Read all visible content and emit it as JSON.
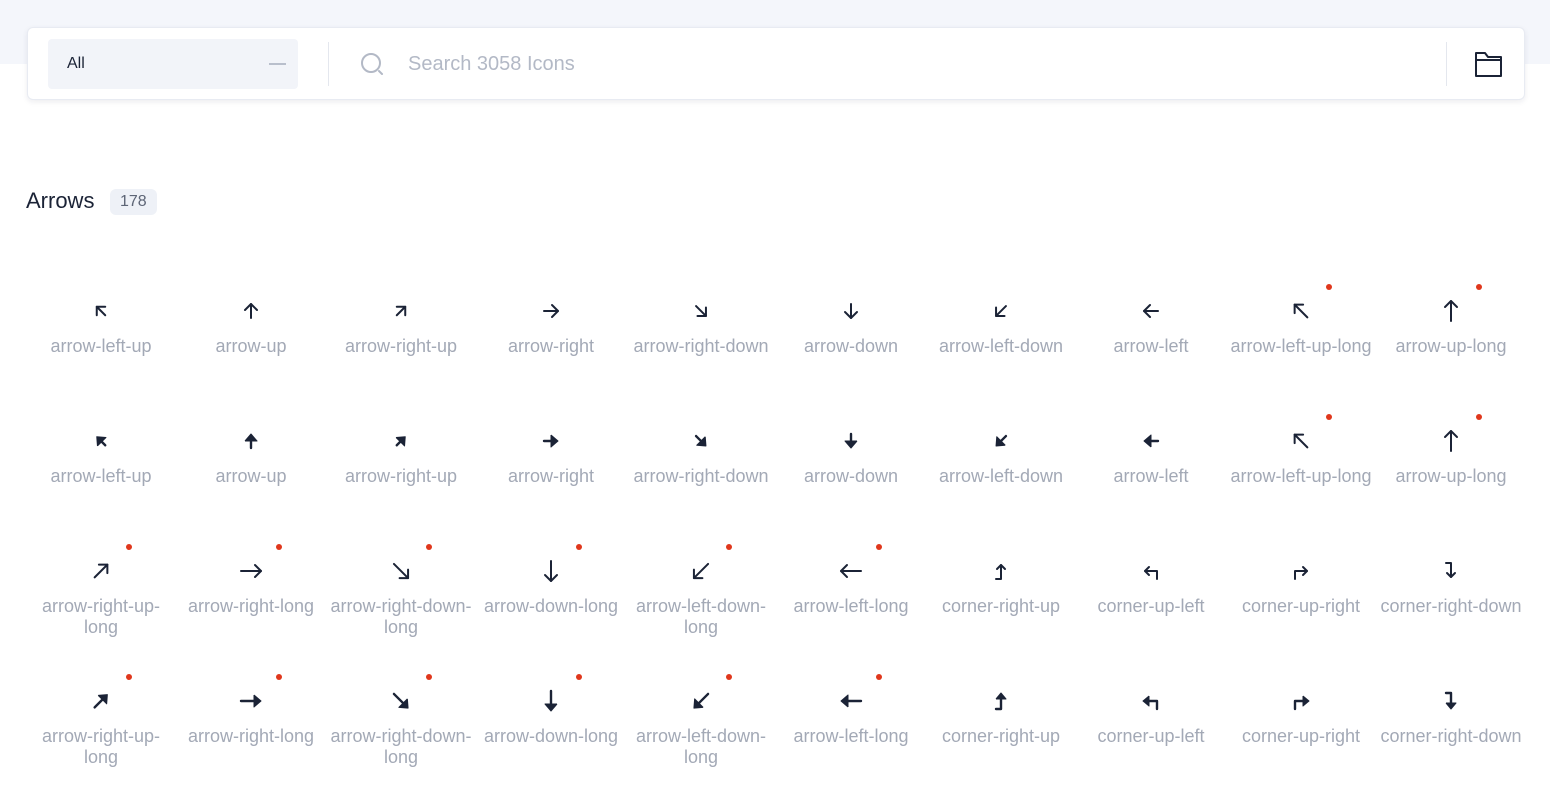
{
  "toolbar": {
    "category": "All",
    "search_placeholder": "Search 3058 Icons"
  },
  "section": {
    "title": "Arrows",
    "count": "178"
  },
  "colors": {
    "icon": "#1b2336",
    "label": "#a3a9b6",
    "new_dot": "#e0371c"
  },
  "icons": [
    {
      "label": "arrow-left-up",
      "shape": "diag-ul",
      "style": "outline",
      "is_new": false
    },
    {
      "label": "arrow-up",
      "shape": "up",
      "style": "outline",
      "is_new": false
    },
    {
      "label": "arrow-right-up",
      "shape": "diag-ur",
      "style": "outline",
      "is_new": false
    },
    {
      "label": "arrow-right",
      "shape": "right",
      "style": "outline",
      "is_new": false
    },
    {
      "label": "arrow-right-down",
      "shape": "diag-dr",
      "style": "outline",
      "is_new": false
    },
    {
      "label": "arrow-down",
      "shape": "down",
      "style": "outline",
      "is_new": false
    },
    {
      "label": "arrow-left-down",
      "shape": "diag-dl",
      "style": "outline",
      "is_new": false
    },
    {
      "label": "arrow-left",
      "shape": "left",
      "style": "outline",
      "is_new": false
    },
    {
      "label": "arrow-left-up-long",
      "shape": "long-ul",
      "style": "outline",
      "is_new": true
    },
    {
      "label": "arrow-up-long",
      "shape": "long-up",
      "style": "outline",
      "is_new": true
    },
    {
      "label": "arrow-left-up",
      "shape": "diag-ul",
      "style": "solid",
      "is_new": false
    },
    {
      "label": "arrow-up",
      "shape": "up",
      "style": "solid",
      "is_new": false
    },
    {
      "label": "arrow-right-up",
      "shape": "diag-ur",
      "style": "solid",
      "is_new": false
    },
    {
      "label": "arrow-right",
      "shape": "right",
      "style": "solid",
      "is_new": false
    },
    {
      "label": "arrow-right-down",
      "shape": "diag-dr",
      "style": "solid",
      "is_new": false
    },
    {
      "label": "arrow-down",
      "shape": "down",
      "style": "solid",
      "is_new": false
    },
    {
      "label": "arrow-left-down",
      "shape": "diag-dl",
      "style": "solid",
      "is_new": false
    },
    {
      "label": "arrow-left",
      "shape": "left",
      "style": "solid",
      "is_new": false
    },
    {
      "label": "arrow-left-up-long",
      "shape": "long-ul",
      "style": "outline",
      "is_new": true
    },
    {
      "label": "arrow-up-long",
      "shape": "long-up",
      "style": "outline",
      "is_new": true
    },
    {
      "label": "arrow-right-up-long",
      "shape": "long-ur",
      "style": "outline",
      "is_new": true
    },
    {
      "label": "arrow-right-long",
      "shape": "long-right",
      "style": "outline",
      "is_new": true
    },
    {
      "label": "arrow-right-down-long",
      "shape": "long-dr",
      "style": "outline",
      "is_new": true
    },
    {
      "label": "arrow-down-long",
      "shape": "long-down",
      "style": "outline",
      "is_new": true
    },
    {
      "label": "arrow-left-down-long",
      "shape": "long-dl",
      "style": "outline",
      "is_new": true
    },
    {
      "label": "arrow-left-long",
      "shape": "long-left",
      "style": "outline",
      "is_new": true
    },
    {
      "label": "corner-right-up",
      "shape": "corner-right-up",
      "style": "outline",
      "is_new": false
    },
    {
      "label": "corner-up-left",
      "shape": "corner-up-left",
      "style": "outline",
      "is_new": false
    },
    {
      "label": "corner-up-right",
      "shape": "corner-up-right",
      "style": "outline",
      "is_new": false
    },
    {
      "label": "corner-right-down",
      "shape": "corner-right-down",
      "style": "outline",
      "is_new": false
    },
    {
      "label": "arrow-right-up-long",
      "shape": "long-ur",
      "style": "solid",
      "is_new": true
    },
    {
      "label": "arrow-right-long",
      "shape": "long-right",
      "style": "solid",
      "is_new": true
    },
    {
      "label": "arrow-right-down-long",
      "shape": "long-dr",
      "style": "solid",
      "is_new": true
    },
    {
      "label": "arrow-down-long",
      "shape": "long-down",
      "style": "solid",
      "is_new": true
    },
    {
      "label": "arrow-left-down-long",
      "shape": "long-dl",
      "style": "solid",
      "is_new": true
    },
    {
      "label": "arrow-left-long",
      "shape": "long-left",
      "style": "solid",
      "is_new": true
    },
    {
      "label": "corner-right-up",
      "shape": "corner-right-up",
      "style": "solid",
      "is_new": false
    },
    {
      "label": "corner-up-left",
      "shape": "corner-up-left",
      "style": "solid",
      "is_new": false
    },
    {
      "label": "corner-up-right",
      "shape": "corner-up-right",
      "style": "solid",
      "is_new": false
    },
    {
      "label": "corner-right-down",
      "shape": "corner-right-down",
      "style": "solid",
      "is_new": false
    }
  ]
}
